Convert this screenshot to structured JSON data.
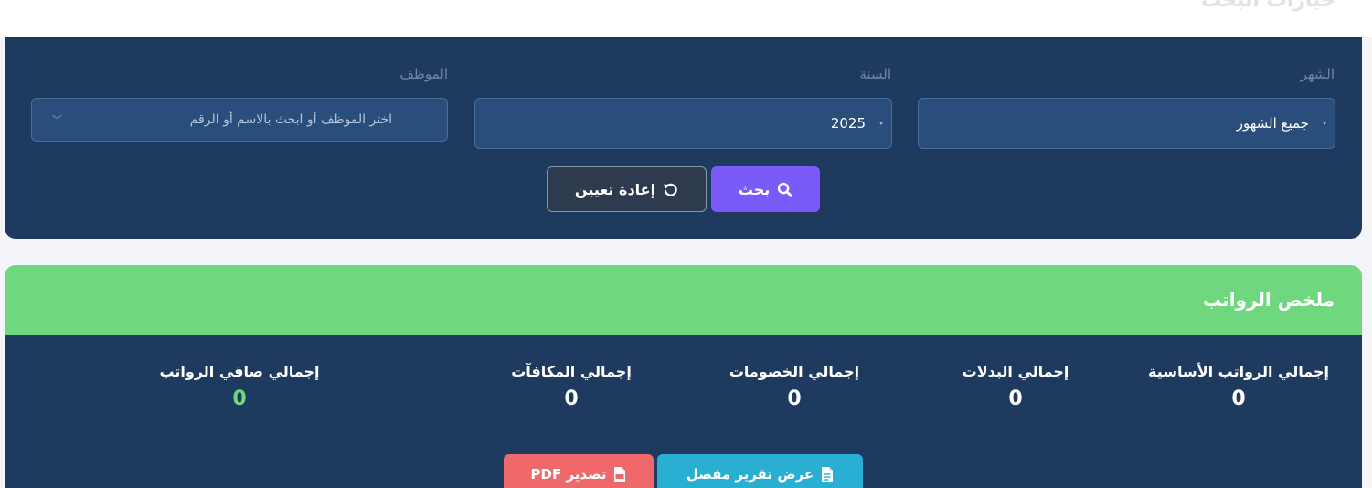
{
  "search_options": {
    "title": "خيارات البحث",
    "month": {
      "label": "الشهر",
      "value": "جميع الشهور"
    },
    "year": {
      "label": "السنة",
      "value": "2025"
    },
    "employee": {
      "label": "الموظف",
      "placeholder": "اختر الموظف أو ابحث بالاسم أو الرقم"
    },
    "search_button": "بحث",
    "reset_button": "إعادة تعيين"
  },
  "summary": {
    "title": "ملخص الرواتب",
    "stats": [
      {
        "label": "إجمالي الرواتب الأساسية",
        "value": "0"
      },
      {
        "label": "إجمالي البدلات",
        "value": "0"
      },
      {
        "label": "إجمالي الخصومات",
        "value": "0"
      },
      {
        "label": "إجمالي المكافآت",
        "value": "0"
      },
      {
        "label": "إجمالي صافي الرواتب",
        "value": "0"
      }
    ],
    "detailed_report_button": "عرض تقرير مفصل",
    "export_pdf_button": "تصدير PDF"
  },
  "colors": {
    "navy_panel": "#1f3a5f",
    "accent_green": "#6fd87e",
    "search_purple": "#7a5af8",
    "report_cyan": "#29afd1",
    "pdf_red": "#f0696a"
  },
  "icons": [
    "search-icon",
    "reset-icon",
    "chevron-down-icon",
    "file-text-icon",
    "pdf-file-icon"
  ]
}
